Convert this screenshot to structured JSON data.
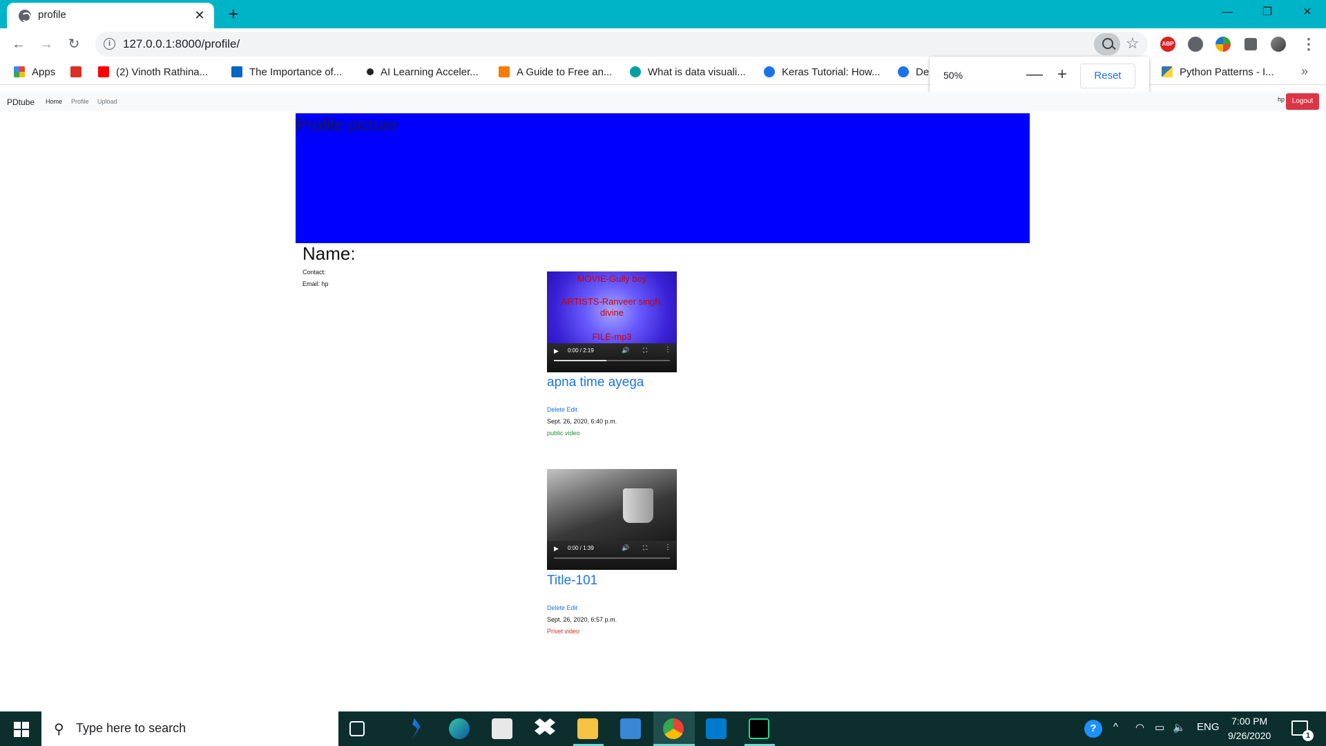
{
  "browser": {
    "tab_title": "profile",
    "url": "127.0.0.1:8000/profile/",
    "bookmarks": [
      {
        "label": "Apps",
        "icon": "apps-grid-icon",
        "color": "#1a73e8"
      },
      {
        "label": "",
        "icon": "gmail-icon",
        "color": "#d93025"
      },
      {
        "label": "(2) Vinoth Rathina...",
        "icon": "youtube-icon",
        "color": "#ff0000"
      },
      {
        "label": "The Importance of...",
        "icon": "linkedin-icon",
        "color": "#0a66c2"
      },
      {
        "label": "AI Learning Acceler...",
        "icon": "dot-icon",
        "color": "#202124"
      },
      {
        "label": "A Guide to Free an...",
        "icon": "chat-bubble-icon",
        "color": "#f57c00"
      },
      {
        "label": "What is data visuali...",
        "icon": "eye-icon",
        "color": "#00a0a0"
      },
      {
        "label": "Keras Tutorial: How...",
        "icon": "p-logo-icon",
        "color": "#1a73e8"
      },
      {
        "label": "De",
        "icon": "p-logo-icon",
        "color": "#1a73e8"
      },
      {
        "label": "Python Patterns - I...",
        "icon": "python-icon",
        "color": "#3776ab"
      }
    ],
    "zoom": {
      "level": "50%",
      "minus": "—",
      "plus": "+",
      "reset": "Reset"
    }
  },
  "site": {
    "brand": "PDtube",
    "nav": [
      "Home",
      "Profile",
      "Upload"
    ],
    "user": "hp",
    "logout": "Logout"
  },
  "profile": {
    "banner_text": "Profile picture",
    "name_label": "Name:",
    "contact_label": "Contact:",
    "email_label": "Email: hp"
  },
  "videos": [
    {
      "title": "apna time ayega",
      "poster_lines": [
        "MOVIE-Gully boy",
        "ARTISTS-Ranveer singh,",
        "divine",
        "FILE-mp3"
      ],
      "time": "0:00 / 2:19",
      "progress": 0.45,
      "actions": "Delete Edit",
      "date": "Sept. 26, 2020, 6:40 p.m.",
      "status": "public video",
      "status_color": "#1e8e3e"
    },
    {
      "title": "Title-101",
      "poster_lines": [],
      "time": "0:00 / 1:39",
      "progress": 0.0,
      "actions": "Delete Edit",
      "date": "Sept. 26, 2020, 6:57 p.m.",
      "status": "Privet video",
      "status_color": "#d93025"
    }
  ],
  "taskbar": {
    "search_placeholder": "Type here to search",
    "lang": "ENG",
    "time": "7:00 PM",
    "date": "9/26/2020",
    "notifications": "1"
  }
}
